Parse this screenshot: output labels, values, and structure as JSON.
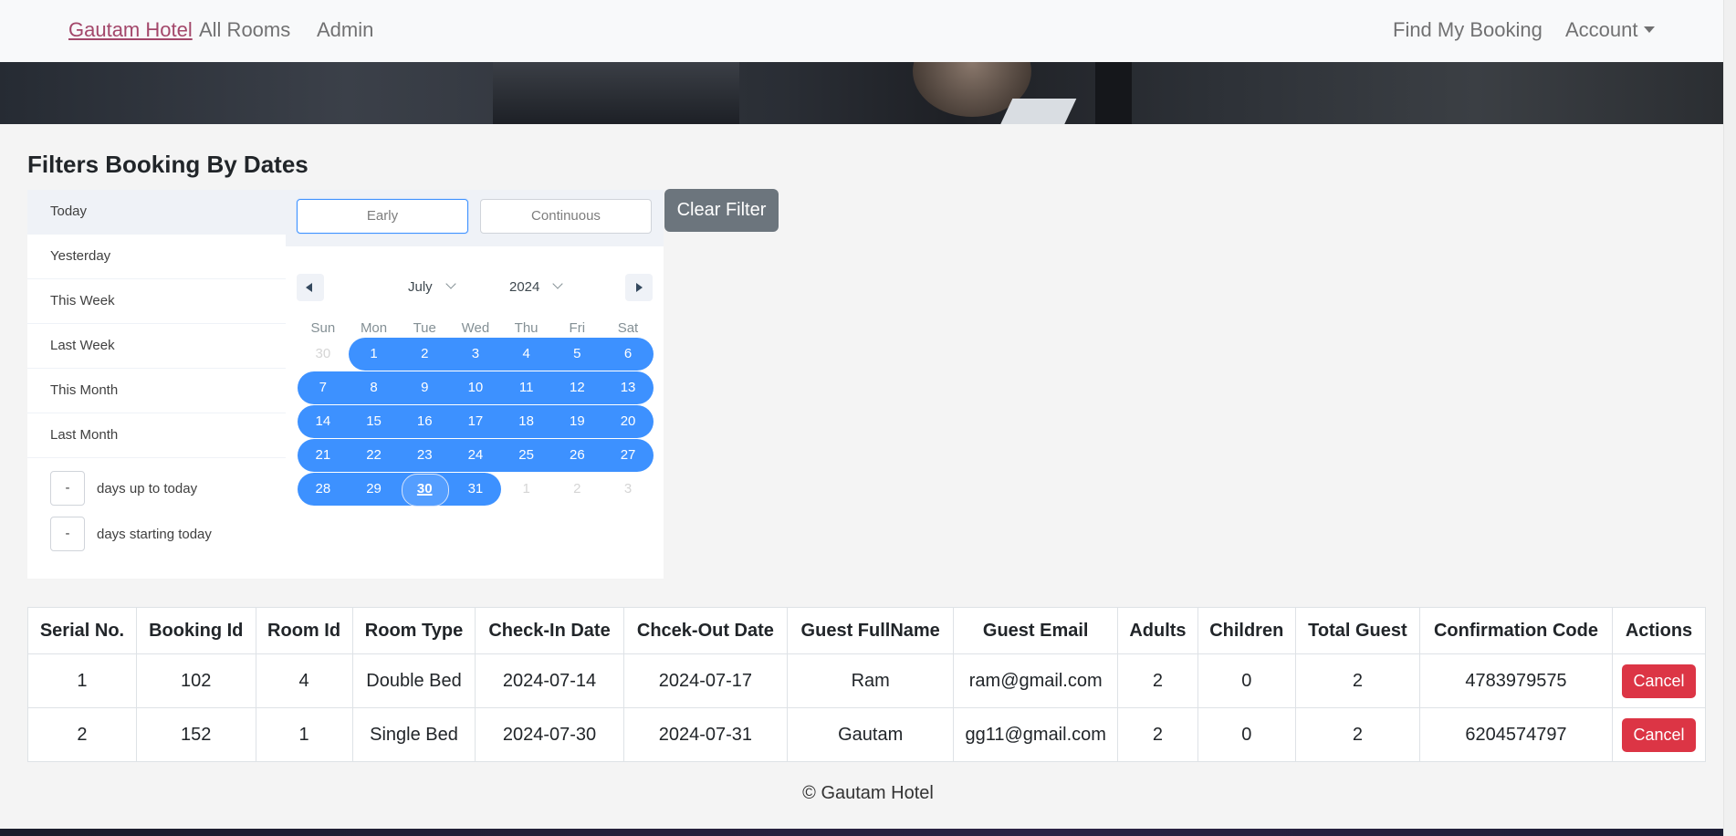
{
  "nav": {
    "brand": "Gautam Hotel",
    "all_rooms": "All Rooms",
    "admin": "Admin",
    "find_booking": "Find My Booking",
    "account": "Account"
  },
  "filter": {
    "title": "Filters Booking By Dates",
    "ranges": [
      "Today",
      "Yesterday",
      "This Week",
      "Last Week",
      "This Month",
      "Last Month"
    ],
    "active_range": "Today",
    "days_up_value": "-",
    "days_up_label": "days up to today",
    "days_start_value": "-",
    "days_start_label": "days starting today",
    "start_input": "Early",
    "end_input": "Continuous",
    "clear_button": "Clear Filter"
  },
  "calendar": {
    "month": "July",
    "year": "2024",
    "weekdays": [
      "Sun",
      "Mon",
      "Tue",
      "Wed",
      "Thu",
      "Fri",
      "Sat"
    ],
    "weeks": [
      [
        "30",
        "1",
        "2",
        "3",
        "4",
        "5",
        "6"
      ],
      [
        "7",
        "8",
        "9",
        "10",
        "11",
        "12",
        "13"
      ],
      [
        "14",
        "15",
        "16",
        "17",
        "18",
        "19",
        "20"
      ],
      [
        "21",
        "22",
        "23",
        "24",
        "25",
        "26",
        "27"
      ],
      [
        "28",
        "29",
        "30",
        "31",
        "1",
        "2",
        "3"
      ]
    ],
    "today": "30",
    "range_color": "#3d91ff"
  },
  "table": {
    "headers": [
      "Serial No.",
      "Booking Id",
      "Room Id",
      "Room Type",
      "Check-In Date",
      "Chcek-Out Date",
      "Guest FullName",
      "Guest Email",
      "Adults",
      "Children",
      "Total Guest",
      "Confirmation Code",
      "Actions"
    ],
    "rows": [
      [
        "1",
        "102",
        "4",
        "Double Bed",
        "2024-07-14",
        "2024-07-17",
        "Ram",
        "ram@gmail.com",
        "2",
        "0",
        "2",
        "4783979575",
        "Cancel"
      ],
      [
        "2",
        "152",
        "1",
        "Single Bed",
        "2024-07-30",
        "2024-07-31",
        "Gautam",
        "gg11@gmail.com",
        "2",
        "0",
        "2",
        "6204574797",
        "Cancel"
      ]
    ]
  },
  "footer": "© Gautam Hotel",
  "colors": {
    "brand_link": "#a3476a",
    "clear_button": "#6c757d",
    "cancel_button": "#dc3545"
  }
}
